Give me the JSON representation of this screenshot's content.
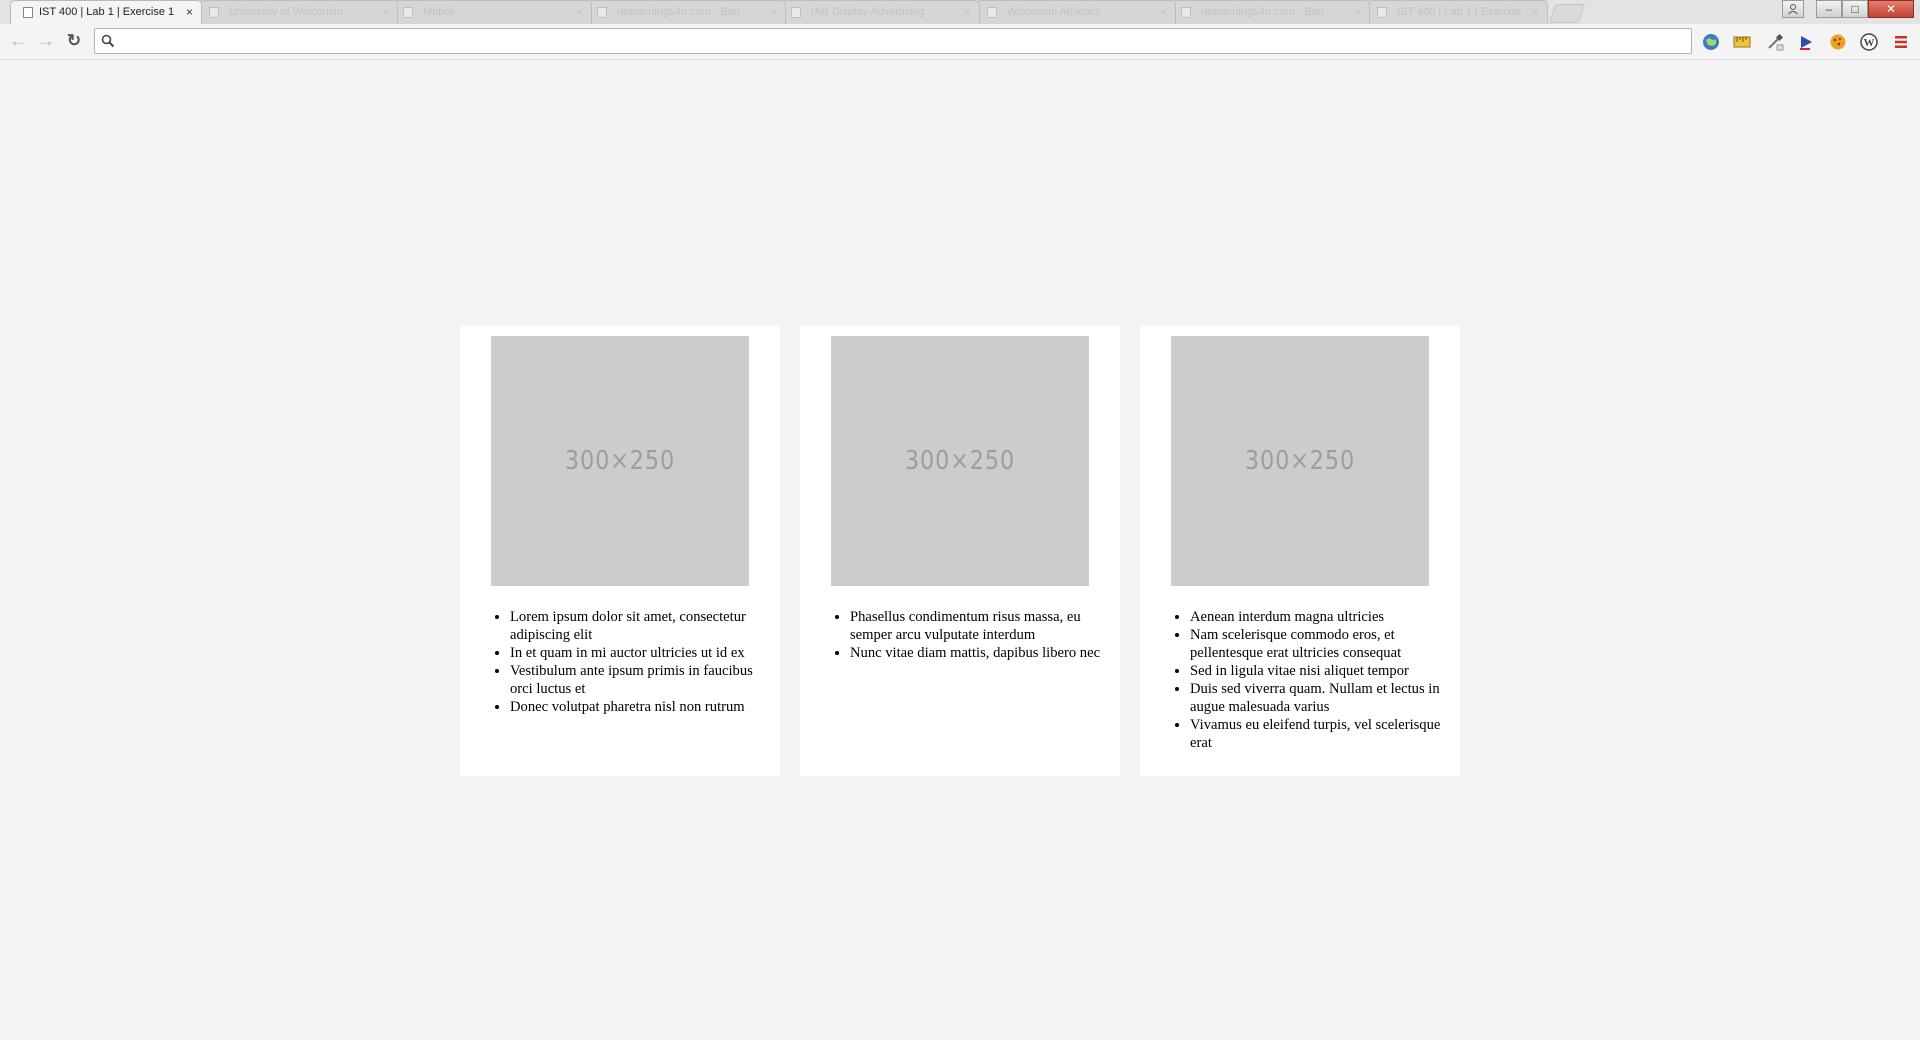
{
  "browser": {
    "tabs": [
      {
        "title": "IST 400 | Lab 1 | Exercise 1",
        "active": true
      },
      {
        "title": "University of Wisconsin",
        "active": false
      },
      {
        "title": "Mobile",
        "active": false
      },
      {
        "title": "netearnings4u.com - Ban",
        "active": false
      },
      {
        "title": "IAB Display Advertising",
        "active": false
      },
      {
        "title": "Wisconsin Athletics",
        "active": false
      },
      {
        "title": "netearnings4u.com - Ban",
        "active": false
      },
      {
        "title": "IST 400 | Lab 1 | Exercise",
        "active": false
      }
    ],
    "tab_close_glyph": "×",
    "address_bar": {
      "value": "",
      "placeholder": ""
    },
    "nav": {
      "back_glyph": "←",
      "forward_glyph": "→",
      "reload_glyph": "↻"
    },
    "window_controls": {
      "minimize": "–",
      "maximize": "□",
      "close": "✕"
    },
    "extensions": [
      "globe-icon",
      "ruler-icon",
      "eyedropper-icon",
      "play-icon",
      "cookie-icon",
      "wordpress-icon",
      "menu-icon"
    ]
  },
  "cards": [
    {
      "placeholder_label": "300×250",
      "items": [
        "Lorem ipsum dolor sit amet, consectetur adipiscing elit",
        "In et quam in mi auctor ultricies ut id ex",
        "Vestibulum ante ipsum primis in faucibus orci luctus et",
        "Donec volutpat pharetra nisl non rutrum"
      ]
    },
    {
      "placeholder_label": "300×250",
      "items": [
        "Phasellus condimentum risus massa, eu semper arcu vulputate interdum",
        "Nunc vitae diam mattis, dapibus libero nec"
      ]
    },
    {
      "placeholder_label": "300×250",
      "items": [
        "Aenean interdum magna ultricies",
        "Nam scelerisque commodo eros, et pellentesque erat ultricies consequat",
        "Sed in ligula vitae nisi aliquet tempor",
        "Duis sed viverra quam. Nullam et lectus in augue malesuada varius",
        "Vivamus eu eleifend turpis, vel scelerisque erat"
      ]
    }
  ]
}
